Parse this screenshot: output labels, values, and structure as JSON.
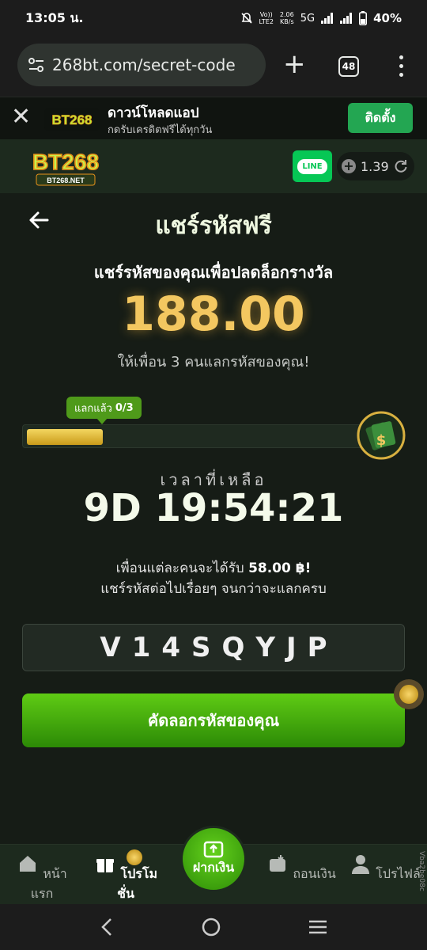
{
  "status_bar": {
    "time": "13:05 น.",
    "net_top": "Vo))",
    "net_bottom": "LTE2",
    "speed_top": "2.06",
    "speed_bottom": "KB/s",
    "network": "5G",
    "battery": "40%"
  },
  "browser": {
    "url": "268bt.com/secret-code",
    "tab_count": "48"
  },
  "app_banner": {
    "title": "ดาวน์โหลดแอป",
    "subtitle": "กดรับเครดิตฟรีได้ทุกวัน",
    "install_label": "ติดตั้ง",
    "logo_text": "BT268"
  },
  "header": {
    "logo_text": "BT268",
    "logo_sub": "BT268.NET",
    "line_label": "LINE",
    "balance": "1.39"
  },
  "page": {
    "title": "แชร์รหัสฟรี",
    "subtitle": "แชร์รหัสของคุณเพื่อปลดล็อกรางวัล",
    "amount": "188.00",
    "invite_text": "ให้เพื่อน 3 คนแลกรหัสของคุณ!",
    "progress_label": "แลกแล้ว",
    "progress_count": "0/3",
    "progress_fill_fraction": 0.22,
    "time_left_label": "เวลาที่เหลือ",
    "countdown": "9D 19:54:21",
    "info_prefix": "เพื่อนแต่ละคนจะได้รับ",
    "info_amount": "58.00 ฿!",
    "info_line2": "แชร์รหัสต่อไปเรื่อยๆ จนกว่าจะแลกครบ",
    "code": "V14SQYJP",
    "copy_button": "คัดลอกรหัสของคุณ"
  },
  "bottom_nav": {
    "home": "หน้าแรก",
    "promotions": "โปรโมชั่น",
    "deposit": "ฝากเงิน",
    "withdraw": "ถอนเงิน",
    "profile": "โปรไฟล์",
    "side_tag": "Vba2be08c"
  },
  "colors": {
    "accent_green": "#4f9a1a",
    "gold": "#f3c760",
    "background": "#161c16",
    "header": "#1d2a1e"
  }
}
